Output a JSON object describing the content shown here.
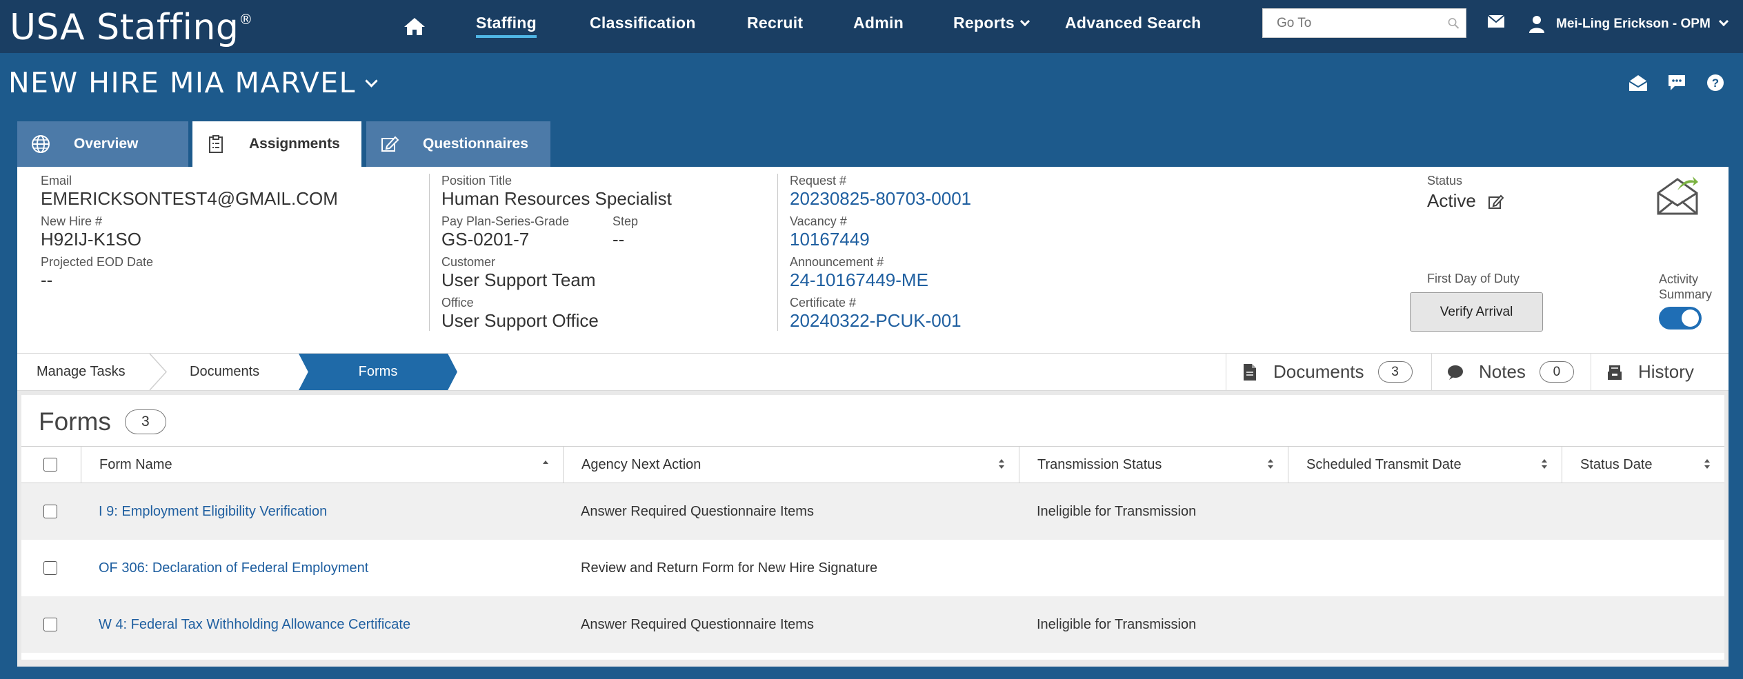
{
  "topbar": {
    "brand": "USA Staffing",
    "brand_mark": "®",
    "nav": [
      "Staffing",
      "Classification",
      "Recruit",
      "Admin",
      "Reports",
      "Advanced Search"
    ],
    "goto_placeholder": "Go To",
    "user_name": "Mei-Ling Erickson - OPM"
  },
  "page": {
    "title": "NEW HIRE MIA MARVEL"
  },
  "tabs": [
    "Overview",
    "Assignments",
    "Questionnaires"
  ],
  "summary": {
    "email_label": "Email",
    "email": "EMERICKSONTEST4@GMAIL.COM",
    "newhire_label": "New Hire #",
    "newhire": "H92IJ-K1SO",
    "eod_label": "Projected EOD Date",
    "eod": "--",
    "position_label": "Position Title",
    "position": "Human Resources Specialist",
    "ppsg_label": "Pay Plan-Series-Grade",
    "ppsg": "GS-0201-7",
    "step_label": "Step",
    "step": "--",
    "customer_label": "Customer",
    "customer": "User Support Team",
    "office_label": "Office",
    "office": "User Support Office",
    "request_label": "Request #",
    "request": "20230825-80703-0001",
    "vacancy_label": "Vacancy #",
    "vacancy": "10167449",
    "announcement_label": "Announcement #",
    "announcement": "24-10167449-ME",
    "certificate_label": "Certificate #",
    "certificate": "20240322-PCUK-001",
    "status_label": "Status",
    "status": "Active",
    "fdod_label": "First Day of Duty",
    "verify_button": "Verify Arrival",
    "activity_label_1": "Activity",
    "activity_label_2": "Summary",
    "activity_on": true
  },
  "steps": [
    "Manage Tasks",
    "Documents",
    "Forms"
  ],
  "side_buttons": [
    {
      "label": "Documents",
      "count": "3"
    },
    {
      "label": "Notes",
      "count": "0"
    },
    {
      "label": "History"
    }
  ],
  "forms": {
    "title": "Forms",
    "count": "3",
    "columns": [
      "Form Name",
      "Agency Next Action",
      "Transmission Status",
      "Scheduled Transmit Date",
      "Status Date"
    ],
    "rows": [
      {
        "name": "I 9: Employment Eligibility Verification",
        "action": "Answer Required Questionnaire Items",
        "transmission": "Ineligible for Transmission",
        "scheduled": "",
        "status_date": ""
      },
      {
        "name": "OF 306: Declaration of Federal Employment",
        "action": "Review and Return Form for New Hire Signature",
        "transmission": "",
        "scheduled": "",
        "status_date": ""
      },
      {
        "name": "W 4: Federal Tax Withholding Allowance Certificate",
        "action": "Answer Required Questionnaire Items",
        "transmission": "Ineligible for Transmission",
        "scheduled": "",
        "status_date": ""
      }
    ]
  }
}
